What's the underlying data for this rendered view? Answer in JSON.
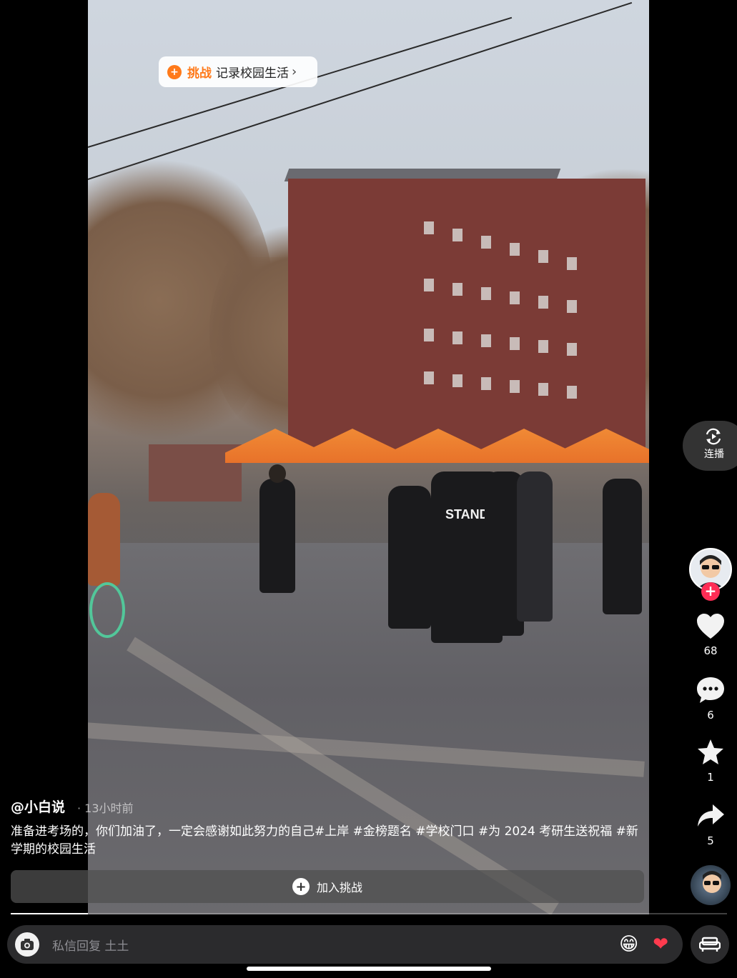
{
  "challenge": {
    "tag": "挑战",
    "text": "记录校园生活"
  },
  "rail": {
    "autoplay_label": "连播",
    "likes": "68",
    "comments": "6",
    "favorites": "1",
    "shares": "5"
  },
  "post": {
    "author": "@小白说",
    "time": "· 13小时前",
    "caption": "准备进考场的，你们加油了，一定会感谢如此努力的自己#上岸 #金榜题名 #学校门口 #为 2024 考研生送祝福 #新学期的校园生活"
  },
  "join_bar": {
    "label": "加入挑战"
  },
  "dm": {
    "placeholder": "私信回复 土土"
  },
  "video_text": {
    "sign": "STAND"
  },
  "icons": [
    "camera-icon",
    "grin-emoji-icon",
    "heart-emoji-icon",
    "sofa-icon",
    "heart-icon",
    "comment-icon",
    "star-icon",
    "share-icon",
    "autoplay-icon"
  ],
  "colors": {
    "accent": "#ff7a1a",
    "follow": "#fe2c55",
    "background": "#000000"
  }
}
